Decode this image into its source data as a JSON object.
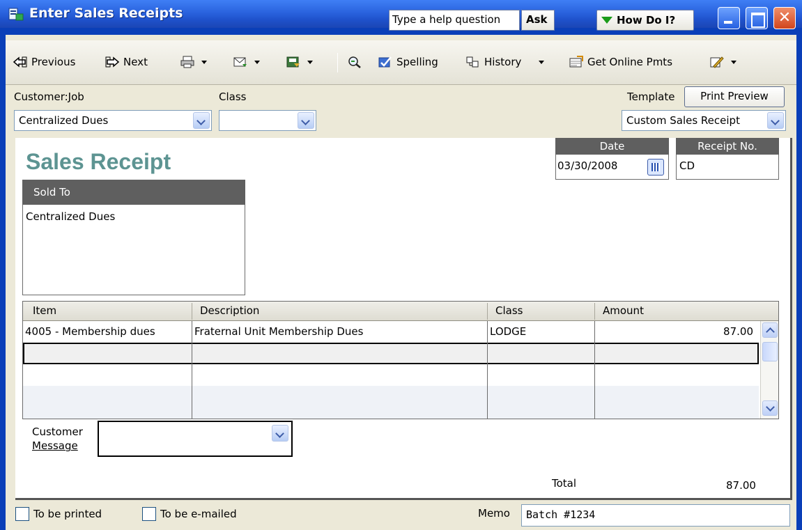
{
  "window": {
    "title": "Enter Sales Receipts",
    "help_placeholder": "Type a help question",
    "ask_label": "Ask",
    "how_do_i_label": "How Do I?",
    "close_glyph": "✕"
  },
  "toolbar": {
    "previous_label": "Previous",
    "next_label": "Next",
    "spelling_label": "Spelling",
    "history_label": "History",
    "get_online_pmts_label": "Get Online Pmts",
    "icons": [
      "previous-icon",
      "next-icon",
      "print-icon",
      "email-icon",
      "save-icon",
      "find-icon",
      "spelling-icon",
      "history-icon",
      "online-payments-icon",
      "customize-icon"
    ]
  },
  "header_fields": {
    "customer_job_label": "Customer:Job",
    "customer_job_value": "Centralized Dues",
    "class_label": "Class",
    "class_value": "",
    "template_label": "Template",
    "print_preview_label": "Print Preview",
    "template_value": "Custom Sales Receipt"
  },
  "form": {
    "title": "Sales Receipt",
    "date_label": "Date",
    "date_value": "03/30/2008",
    "receipt_no_label": "Receipt No.",
    "receipt_no_value": "CD",
    "sold_to_label": "Sold To",
    "sold_to_value": "Centralized Dues"
  },
  "line_items": {
    "columns": [
      "Item",
      "Description",
      "Class",
      "Amount"
    ],
    "rows": [
      {
        "item": "4005 - Membership dues",
        "description": "Fraternal Unit Membership Dues",
        "class": "LODGE",
        "amount": "87.00"
      },
      {
        "item": "",
        "description": "",
        "class": "",
        "amount": ""
      },
      {
        "item": "",
        "description": "",
        "class": "",
        "amount": ""
      },
      {
        "item": "",
        "description": "",
        "class": "",
        "amount": ""
      }
    ]
  },
  "customer_message": {
    "label_line1": "Customer",
    "label_line2": "Message",
    "value": ""
  },
  "totals": {
    "total_label": "Total",
    "total_value": "87.00"
  },
  "footer": {
    "to_be_printed_label": "To be printed",
    "to_be_emailed_label": "To be e-mailed",
    "to_be_printed_checked": false,
    "to_be_emailed_checked": false,
    "memo_label": "Memo",
    "memo_value": "Batch #1234"
  },
  "colors": {
    "title_bar": "#2a63de",
    "form_title": "#5d9492",
    "section_header": "#5f5f5f",
    "dialog_background": "#ece9d8"
  }
}
